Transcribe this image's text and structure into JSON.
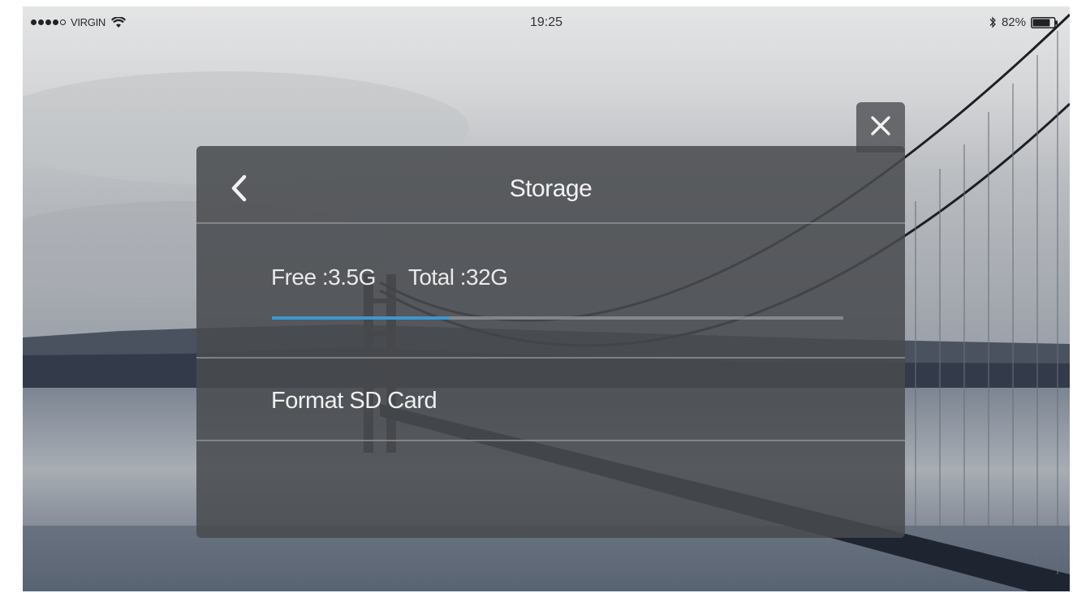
{
  "status_bar": {
    "carrier": "VIRGIN",
    "signal_bars_filled": 4,
    "signal_bars_total": 5,
    "time": "19:25",
    "battery_percent": "82%",
    "battery_level": 0.82
  },
  "modal": {
    "title": "Storage",
    "back_icon": "chevron-left-icon",
    "close_icon": "close-icon",
    "storage": {
      "free_label": "Free :",
      "free_value": "3.5G",
      "total_label": "Total :",
      "total_value": "32G",
      "used_fraction": 0.31
    },
    "format_label": "Format SD Card"
  },
  "colors": {
    "accent": "#3f95cc",
    "panel": "#484a4e",
    "text": "#eeeeee"
  }
}
